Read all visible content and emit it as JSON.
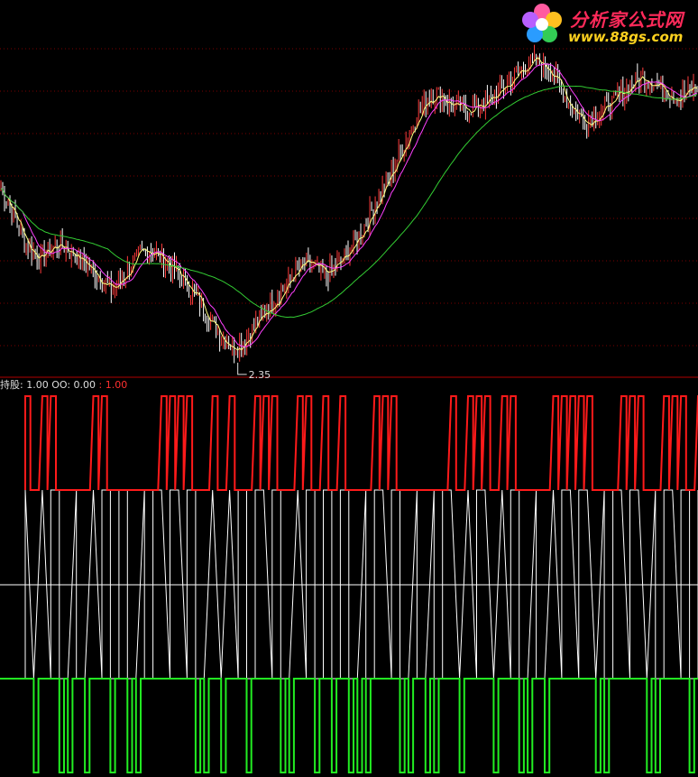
{
  "logo": {
    "cn_text": "分析家公式网",
    "url_text": "www.88gs.com"
  },
  "price_panel": {
    "low_marker": "2.35",
    "colors": {
      "up": "#ff3b3b",
      "down": "#ffffff",
      "ma_short": "#ffff80",
      "ma_mid": "#ff40ff",
      "ma_long": "#33cc33",
      "grid": "#7a0000"
    }
  },
  "indicator_panel": {
    "legend_label_1": "持股: 1.00",
    "legend_label_2": "OO: 0.00",
    "legend_label_3": ": 1.00",
    "colors": {
      "hold": "#ff1a1a",
      "mid": "#ffffff",
      "empty": "#22ee22"
    }
  },
  "chart_data": [
    {
      "type": "candlestick",
      "title": "",
      "annotations": [
        "2.35"
      ],
      "series": [
        {
          "values": [
            3.42,
            3.3,
            3.15,
            3.02,
            2.96,
            3.0,
            3.05,
            3.02,
            2.98,
            2.92,
            2.86,
            2.8,
            2.74,
            2.82,
            2.9,
            2.98,
            3.02,
            2.97,
            2.92,
            2.85,
            2.78,
            2.7,
            2.6,
            2.5,
            2.42,
            2.36,
            2.4,
            2.48,
            2.56,
            2.64,
            2.72,
            2.8,
            2.88,
            2.92,
            2.88,
            2.84,
            2.9,
            2.96,
            3.05,
            3.15,
            3.28,
            3.4,
            3.52,
            3.65,
            3.8,
            3.92,
            4.02,
            4.05,
            4.0,
            3.96,
            3.94,
            3.96,
            3.98,
            4.02,
            4.08,
            4.14,
            4.2,
            4.26,
            4.25,
            4.22,
            4.12,
            4.0,
            3.92,
            3.86,
            3.9,
            3.95,
            4.0,
            4.06,
            4.12,
            4.16,
            4.14,
            4.1,
            4.06,
            4.02,
            4.06,
            4.1
          ]
        }
      ]
    },
    {
      "type": "line",
      "title": "",
      "series": [
        {
          "name": "持股",
          "values": [
            1,
            0,
            1,
            1,
            0,
            0,
            0,
            0,
            1,
            1,
            0,
            0,
            0,
            0,
            0,
            0,
            1,
            1,
            1,
            1,
            0,
            0,
            1,
            0,
            1,
            0,
            0,
            1,
            1,
            1,
            0,
            0,
            1,
            1,
            0,
            1,
            0,
            1,
            0,
            0,
            0,
            1,
            1,
            1,
            0,
            0,
            0,
            0,
            0,
            0,
            1,
            0,
            1,
            1,
            1,
            0,
            1,
            1,
            0,
            0,
            0,
            0,
            1,
            1,
            1,
            1,
            1,
            0,
            0,
            0,
            1,
            1,
            1,
            0,
            0,
            1,
            1,
            1,
            0,
            1
          ]
        },
        {
          "name": "OO",
          "values": [
            0,
            1,
            0,
            0,
            1,
            1,
            0,
            1,
            0,
            0,
            1,
            0,
            1,
            1,
            0,
            0,
            0,
            0,
            0,
            0,
            1,
            1,
            0,
            1,
            0,
            0,
            1,
            0,
            0,
            0,
            1,
            1,
            0,
            0,
            1,
            0,
            1,
            0,
            1,
            1,
            1,
            0,
            0,
            0,
            1,
            1,
            0,
            1,
            1,
            0,
            0,
            1,
            0,
            0,
            0,
            1,
            0,
            0,
            1,
            1,
            0,
            1,
            0,
            0,
            0,
            0,
            0,
            1,
            1,
            0,
            0,
            0,
            0,
            1,
            1,
            0,
            0,
            0,
            1,
            0
          ]
        }
      ]
    }
  ]
}
